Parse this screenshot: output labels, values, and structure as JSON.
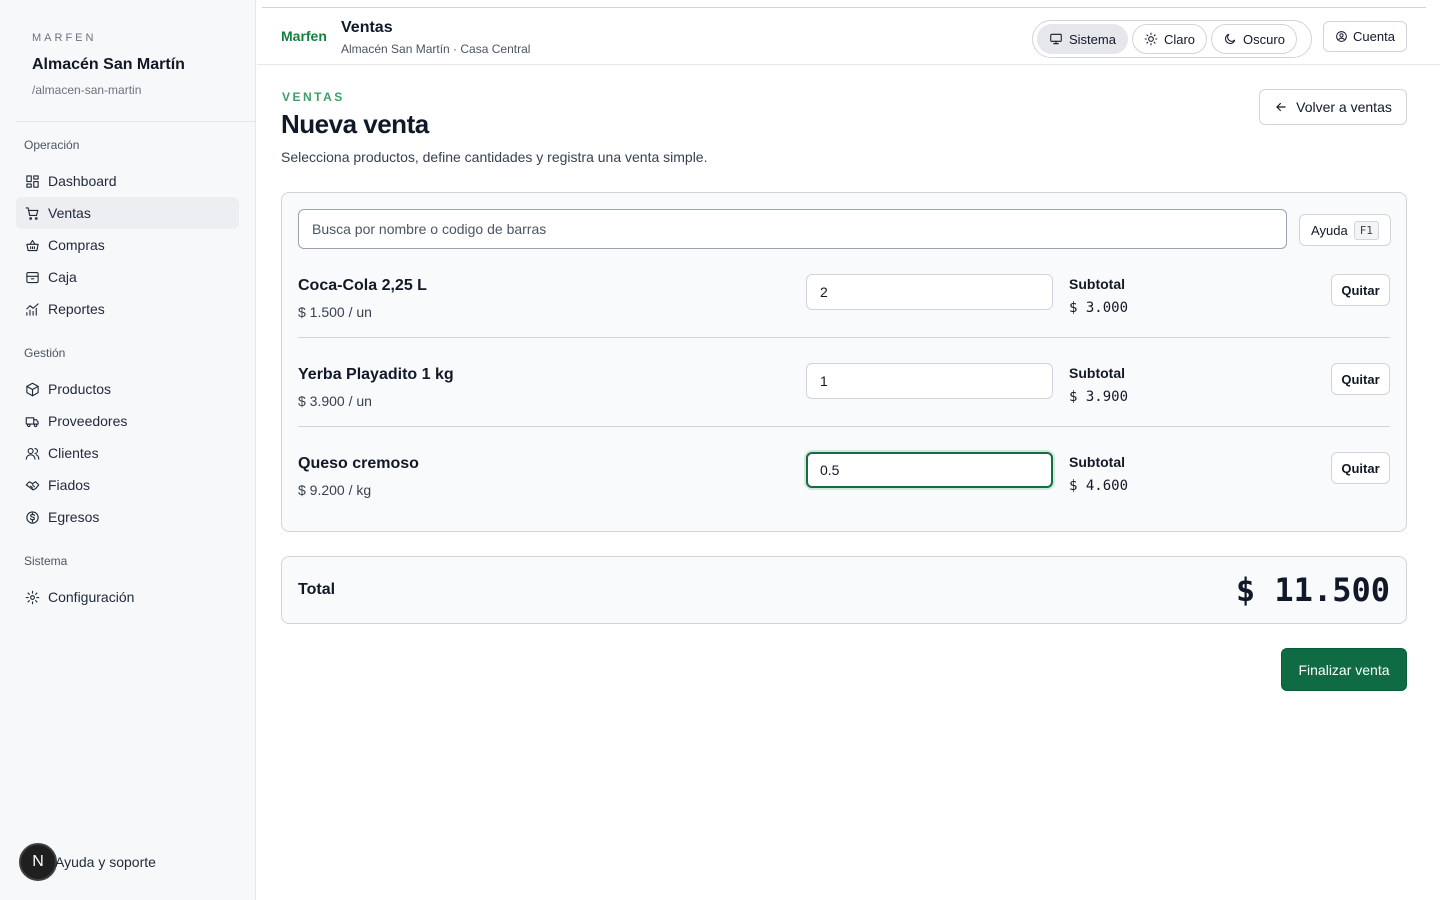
{
  "sidebar": {
    "eyebrow": "MARFEN",
    "store_name": "Almacén San Martín",
    "slug": "/almacen-san-martin",
    "groups": [
      {
        "title": "Operación",
        "items": [
          {
            "label": "Dashboard",
            "icon": "dashboard-icon"
          },
          {
            "label": "Ventas",
            "icon": "cart-icon",
            "active": true
          },
          {
            "label": "Compras",
            "icon": "basket-icon"
          },
          {
            "label": "Caja",
            "icon": "cash-box-icon"
          },
          {
            "label": "Reportes",
            "icon": "chart-icon"
          }
        ]
      },
      {
        "title": "Gestión",
        "items": [
          {
            "label": "Productos",
            "icon": "box-icon"
          },
          {
            "label": "Proveedores",
            "icon": "truck-icon"
          },
          {
            "label": "Clientes",
            "icon": "users-icon"
          },
          {
            "label": "Fiados",
            "icon": "handshake-icon"
          },
          {
            "label": "Egresos",
            "icon": "dollar-circle-icon"
          }
        ]
      },
      {
        "title": "Sistema",
        "items": [
          {
            "label": "Configuración",
            "icon": "gear-icon"
          }
        ]
      }
    ],
    "help": {
      "avatar_letter": "N",
      "label": "Ayuda y soporte"
    }
  },
  "header": {
    "brand": "Marfen",
    "title": "Ventas",
    "subtitle": "Almacén San Martín · Casa Central",
    "theme": {
      "system": "Sistema",
      "light": "Claro",
      "dark": "Oscuro",
      "selected": "Sistema"
    },
    "account": "Cuenta"
  },
  "main": {
    "eyebrow": "VENTAS",
    "title": "Nueva venta",
    "description": "Selecciona productos, define cantidades y registra una venta simple.",
    "back_label": "Volver a ventas",
    "search_placeholder": "Busca por nombre o codigo de barras",
    "help_label": "Ayuda",
    "help_key": "F1",
    "subtotal_label": "Subtotal",
    "remove_label": "Quitar",
    "items": [
      {
        "name": "Coca-Cola 2,25 L",
        "price": "$ 1.500 / un",
        "qty": "2",
        "subtotal": "$ 3.000"
      },
      {
        "name": "Yerba Playadito 1 kg",
        "price": "$ 3.900 / un",
        "qty": "1",
        "subtotal": "$ 3.900"
      },
      {
        "name": "Queso cremoso",
        "price": "$ 9.200 / kg",
        "qty": "0.5",
        "subtotal": "$ 4.600"
      }
    ],
    "total_label": "Total",
    "total_value": "$ 11.500",
    "finish_label": "Finalizar venta"
  },
  "colors": {
    "accent": "#0f6b44",
    "brand_text": "#15803d",
    "eyebrow": "#3f9e6b"
  }
}
